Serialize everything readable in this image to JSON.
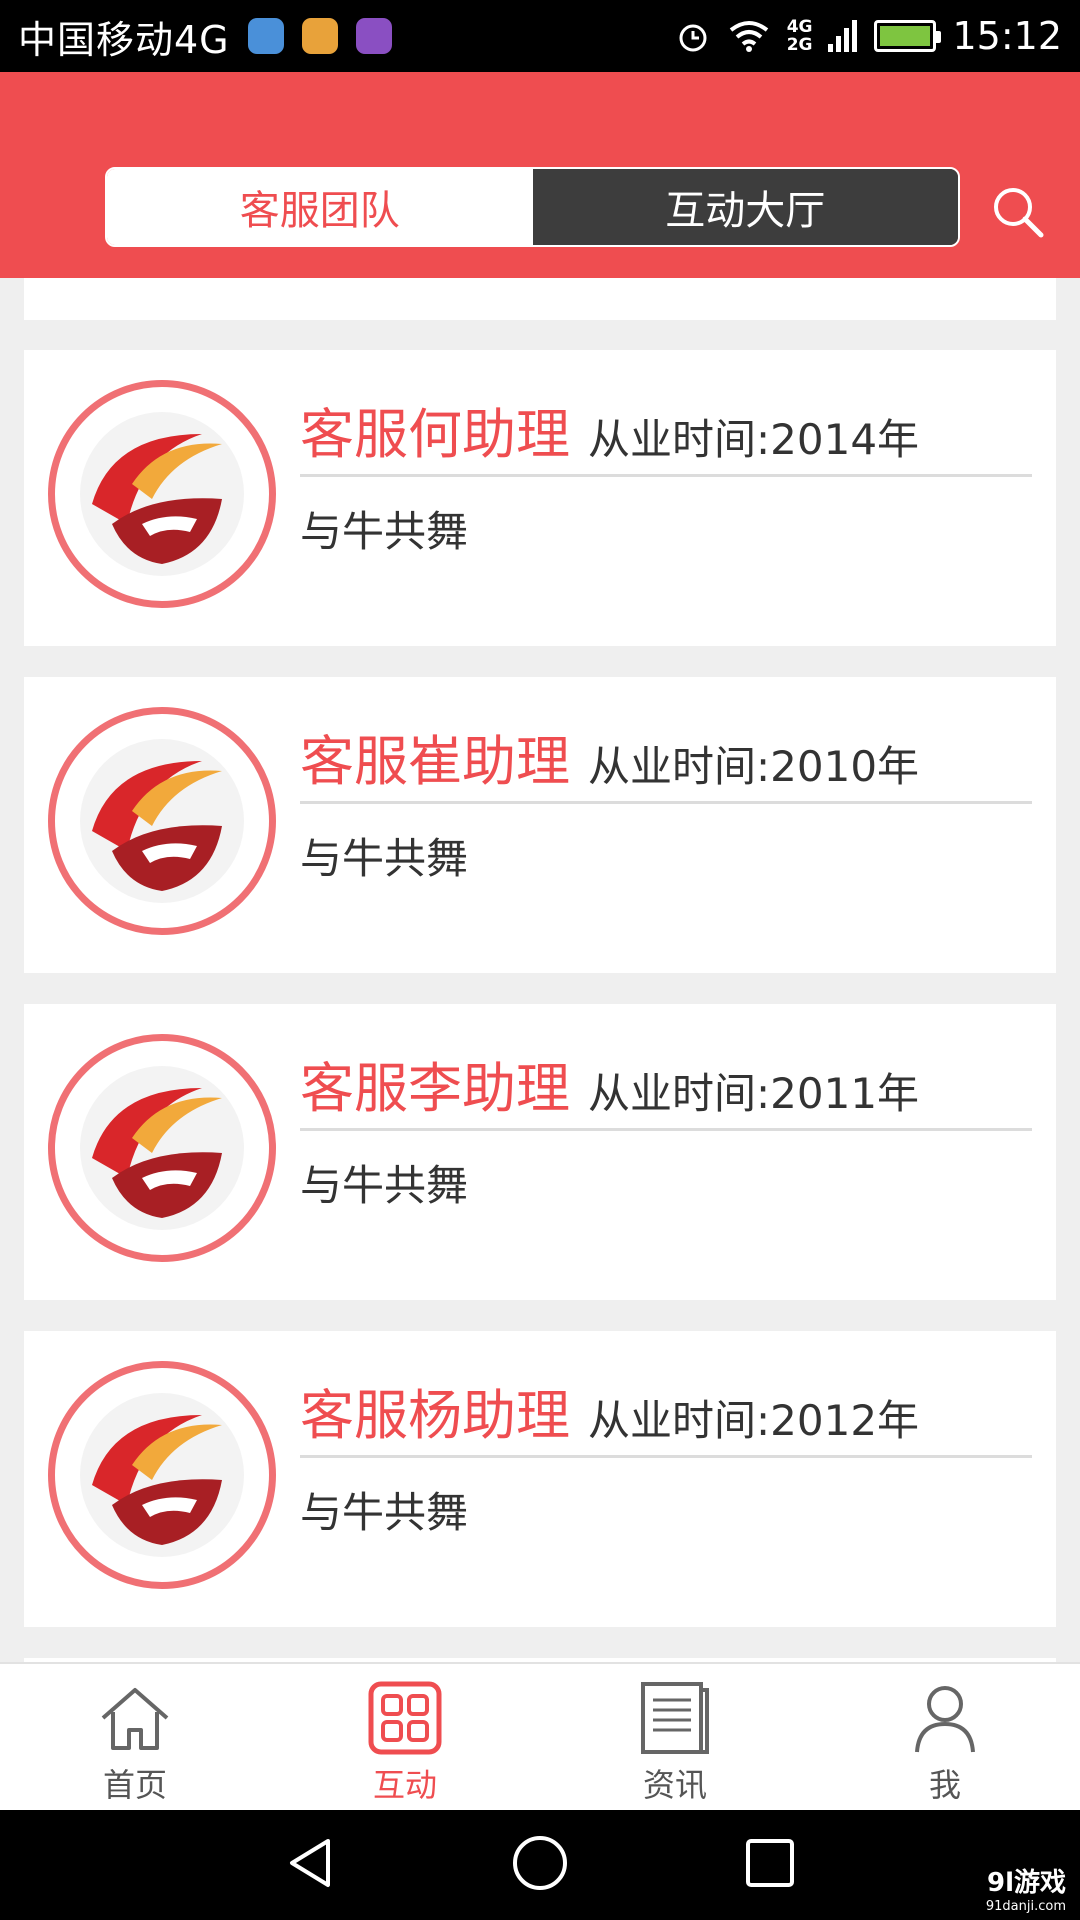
{
  "status_bar": {
    "carrier": "中国移动4G",
    "net_top": "4G",
    "net_bottom": "2G",
    "time": "15:12",
    "battery_level": 1.0
  },
  "header": {
    "tabs": [
      {
        "label": "客服团队",
        "active": true
      },
      {
        "label": "互动大厅",
        "active": false
      }
    ],
    "search_icon": "search-icon"
  },
  "service_list": [
    {
      "name": "客服何助理",
      "years": "从业时间:2014年",
      "motto": "与牛共舞"
    },
    {
      "name": "客服崔助理",
      "years": "从业时间:2010年",
      "motto": "与牛共舞"
    },
    {
      "name": "客服李助理",
      "years": "从业时间:2011年",
      "motto": "与牛共舞"
    },
    {
      "name": "客服杨助理",
      "years": "从业时间:2012年",
      "motto": "与牛共舞"
    }
  ],
  "bottom_tabs": [
    {
      "label": "首页",
      "icon": "home-icon",
      "active": false
    },
    {
      "label": "互动",
      "icon": "grid-icon",
      "active": true
    },
    {
      "label": "资讯",
      "icon": "news-icon",
      "active": false
    },
    {
      "label": "我",
      "icon": "person-icon",
      "active": false
    }
  ],
  "watermark": {
    "main": "9l游戏",
    "sub": "91danji.com"
  },
  "colors": {
    "accent": "#ef4d50",
    "segment_dark": "#3d3d3d",
    "background": "#efefef"
  }
}
